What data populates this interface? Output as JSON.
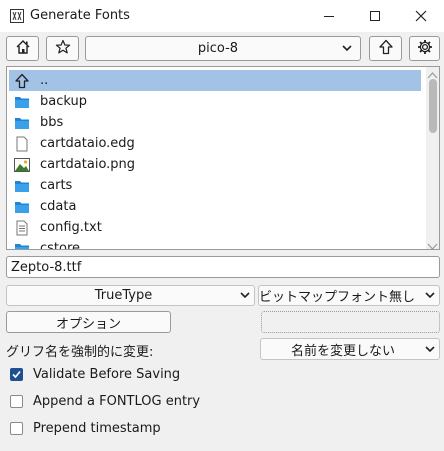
{
  "window": {
    "title": "Generate Fonts"
  },
  "toolbar": {
    "directory": "pico-8"
  },
  "files": [
    {
      "name": "..",
      "icon": "up-arrow-icon",
      "selected": true
    },
    {
      "name": "backup",
      "icon": "folder-icon"
    },
    {
      "name": "bbs",
      "icon": "folder-icon"
    },
    {
      "name": "cartdataio.edg",
      "icon": "blank-file-icon"
    },
    {
      "name": "cartdataio.png",
      "icon": "image-file-icon"
    },
    {
      "name": "carts",
      "icon": "folder-icon"
    },
    {
      "name": "cdata",
      "icon": "folder-icon"
    },
    {
      "name": "config.txt",
      "icon": "text-file-icon"
    },
    {
      "name": "cstore",
      "icon": "folder-icon"
    }
  ],
  "filename": {
    "value": "Zepto-8.ttf"
  },
  "outline_type": {
    "value": "TrueType"
  },
  "bitmap_type": {
    "value": "ビットマップフォント無し"
  },
  "options_button": {
    "label": "オプション"
  },
  "rename": {
    "label": "グリフ名を強制的に変更:",
    "value": "名前を変更しない"
  },
  "checkboxes": [
    {
      "label": "Validate Before Saving",
      "checked": true
    },
    {
      "label": "Append a FONTLOG entry",
      "checked": false
    },
    {
      "label": "Prepend timestamp",
      "checked": false
    }
  ],
  "colors": {
    "selection": "#a2c3e6",
    "folder": "#1f86d6",
    "checkbox_checked": "#1e4f91"
  }
}
